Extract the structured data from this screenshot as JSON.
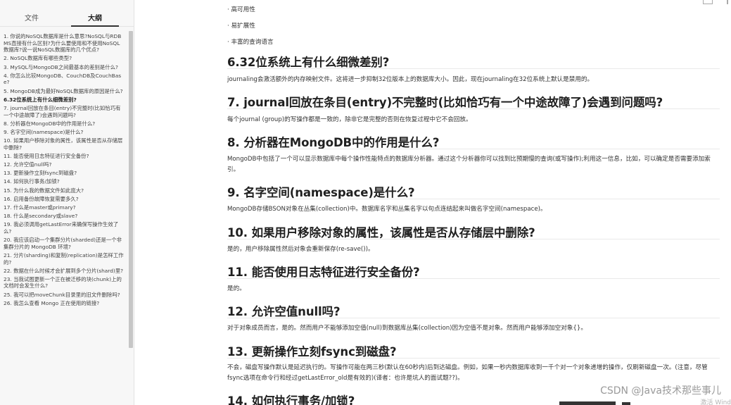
{
  "sidebar": {
    "tabs": [
      {
        "label": "文件"
      },
      {
        "label": "大纲"
      }
    ],
    "outline": [
      "1. 你说的NoSQL数据库是什么意思?NoSQL与RDBMS直接有什么区别?为什么要使用和不使用NoSQL数据库?说一说NoSQL数据库的几个优点?",
      "2. NoSQL数据库有哪些类型?",
      "3. MySQL与MongoDB之间最基本的差别是什么?",
      "4. 你怎么比较MongoDB、CouchDB及CouchBase?",
      "5. MongoDB成为最好NoSQL数据库的原因是什么?",
      "6.32位系统上有什么细微差别?",
      "7. journal回放在条目(entry)不完整时(比如恰巧有一个中途故障了)会遇到问题吗?",
      "8. 分析器在MongoDB中的作用是什么?",
      "9. 名字空间(namespace)是什么?",
      "10. 如果用户移除对象的属性，该属性是否从存储层中删除?",
      "11. 能否使用日志特征进行安全备份?",
      "12. 允许空值null吗?",
      "13. 更新操作立刻fsync到磁盘?",
      "14. 如何执行事务/加锁?",
      "15. 为什么我的数据文件如此庞大?",
      "16. 启用备份故障恢复需要多久?",
      "17. 什么是master或primary?",
      "18. 什么是secondary或slave?",
      "19. 我必须调用getLastError来确保写操作生效了么?",
      "20. 我应该启动一个集群分片(sharded)还是一个非集群分片的 MongoDB 环境?",
      "21. 分片(sharding)和复制(replication)是怎样工作的?",
      "22. 数据在什么时候才会扩展到多个分片(shard)里?",
      "23. 当我试图更新一个正在被迁移的块(chunk)上的文档时会发生什么?",
      "25. 我可以把moveChunk目录里的旧文件删除吗?",
      "26. 我怎么查看 Mongo 正在使用的链接?"
    ],
    "active_index": 5
  },
  "content": {
    "top_bullets": [
      "· 高可用性",
      "· 易扩展性",
      "· 丰富的查询语言"
    ],
    "sections": [
      {
        "heading": "6.32位系统上有什么细微差别?",
        "body": "journaling会激活额外的内存映射文件。这将进一步抑制32位版本上的数据库大小。因此，现在journaling在32位系统上默认是禁用的。"
      },
      {
        "heading": "7. journal回放在条目(entry)不完整时(比如恰巧有一个中途故障了)会遇到问题吗?",
        "body": "每个journal (group)的写操作都是一致的，除非它是完整的否则在恢复过程中它不会回放。"
      },
      {
        "heading": "8. 分析器在MongoDB中的作用是什么?",
        "body": "MongoDB中包括了一个可以显示数据库中每个操作性能特点的数据库分析器。通过这个分析器你可以找到比预期慢的查询(或写操作);利用这一信息，比如，可以确定是否需要添加索引。"
      },
      {
        "heading": "9. 名字空间(namespace)是什么?",
        "body": "MongoDB存储BSON对象在丛集(collection)中。数据库名字和丛集名字以句点连结起来叫做名字空间(namespace)。"
      },
      {
        "heading": "10. 如果用户移除对象的属性，该属性是否从存储层中删除?",
        "body": "是的，用户移除属性然后对象会重新保存(re-save())。"
      },
      {
        "heading": "11. 能否使用日志特征进行安全备份?",
        "body": "是的。"
      },
      {
        "heading": "12. 允许空值null吗?",
        "body": "对于对象成员而言，是的。然而用户不能够添加空值(null)到数据库丛集(collection)因为空值不是对象。然而用户能够添加空对象{}。"
      },
      {
        "heading": "13. 更新操作立刻fsync到磁盘?",
        "body": "不会，磁盘写操作默认是延迟执行的。写操作可能在两三秒(默认在60秒内)后到达磁盘。例如，如果一秒内数据库收到一千个对一个对象递增的操作，仅刷新磁盘一次。(注意，尽管fsync选项在命令行和经过getLastError_old是有效的)(译者：也许是坑人的面试题??)。"
      },
      {
        "heading": "14. 如何执行事务/加锁?",
        "body": ""
      }
    ]
  },
  "watermark": {
    "text": "CSDN @Java技术那些事儿",
    "sub": "激活 Wind"
  }
}
